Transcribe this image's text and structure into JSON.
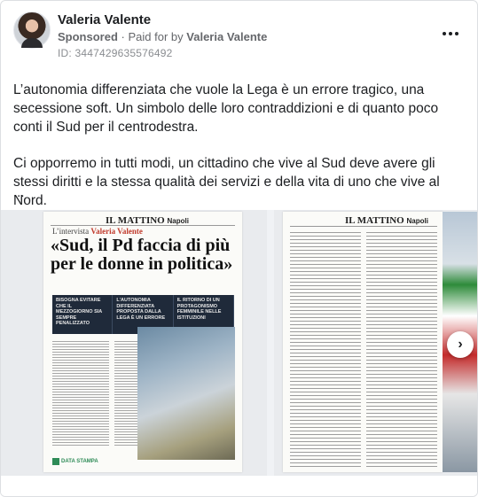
{
  "post": {
    "author": "Valeria Valente",
    "sponsored": "Sponsored",
    "paid_for_prefix": "Paid for by",
    "paid_for_name": "Valeria Valente",
    "separator": "·",
    "ad_id": "ID: 3447429635576492",
    "paragraph1": "L’autonomia differenziata che vuole la Lega è un errore tragico, una secessione soft. Un simbolo delle loro contraddizioni e di quanto poco conti il Sud per il centrodestra.",
    "paragraph2": "Ci opporremo in tutti modi, un cittadino che vive al Sud deve avere gli stessi diritti e la stessa qualità dei servizi e della vita di uno che vive al Nord.",
    "ellipsis": "..."
  },
  "carousel": {
    "slide1": {
      "masthead": "IL MATTINO",
      "masthead_sub": "Napoli",
      "kicker_prefix": "L’intervista",
      "kicker_name": "Valeria Valente",
      "headline": "«Sud, il Pd faccia di più per le donne in politica»",
      "quotes": [
        "Bisogna evitare che il Mezzogiorno sia sempre penalizzato",
        "L'autonomia differenziata proposta dalla Lega è un errore",
        "Il ritorno di un protagonismo femminile nelle istituzioni"
      ],
      "logo": "DATA STAMPA"
    },
    "slide2": {
      "masthead": "IL MATTINO",
      "masthead_sub": "Napoli"
    },
    "next_icon": "›"
  },
  "icons": {
    "more": "more-dots-icon",
    "next": "chevron-right-icon"
  },
  "colors": {
    "text": "#1c1e21",
    "secondary": "#65676b",
    "kicker": "#c0392b"
  }
}
